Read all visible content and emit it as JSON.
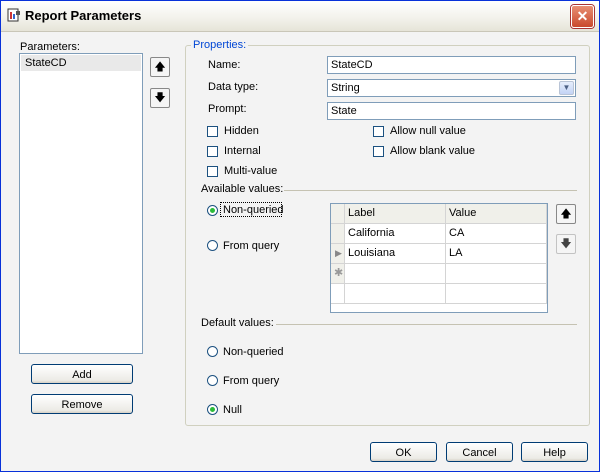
{
  "window": {
    "title": "Report Parameters",
    "icon": "report-icon",
    "close_icon": "close-icon"
  },
  "parameters": {
    "label": "Parameters:",
    "items": [
      "StateCD"
    ],
    "add_label": "Add",
    "remove_label": "Remove",
    "up_icon": "arrow-up-icon",
    "down_icon": "arrow-down-icon"
  },
  "properties": {
    "title": "Properties:",
    "name_label": "Name:",
    "name_value": "StateCD",
    "datatype_label": "Data type:",
    "datatype_value": "String",
    "prompt_label": "Prompt:",
    "prompt_value": "State",
    "checks": {
      "hidden": {
        "label": "Hidden",
        "checked": false
      },
      "internal": {
        "label": "Internal",
        "checked": false
      },
      "multivalue": {
        "label": "Multi-value",
        "checked": false
      },
      "allow_null": {
        "label": "Allow null value",
        "checked": false
      },
      "allow_blank": {
        "label": "Allow blank value",
        "checked": false
      }
    }
  },
  "available_values": {
    "label": "Available values:",
    "non_queried_label": "Non-queried",
    "from_query_label": "From query",
    "selected": "non-queried",
    "columns": [
      "Label",
      "Value"
    ],
    "rows": [
      [
        "California",
        "CA"
      ],
      [
        "Louisiana",
        "LA"
      ]
    ],
    "new_row_icon": "asterisk-icon",
    "current_row_icon": "row-pointer-icon"
  },
  "default_values": {
    "label": "Default values:",
    "non_queried_label": "Non-queried",
    "from_query_label": "From query",
    "null_label": "Null",
    "selected": "null"
  },
  "footer": {
    "ok_label": "OK",
    "cancel_label": "Cancel",
    "help_label": "Help"
  }
}
